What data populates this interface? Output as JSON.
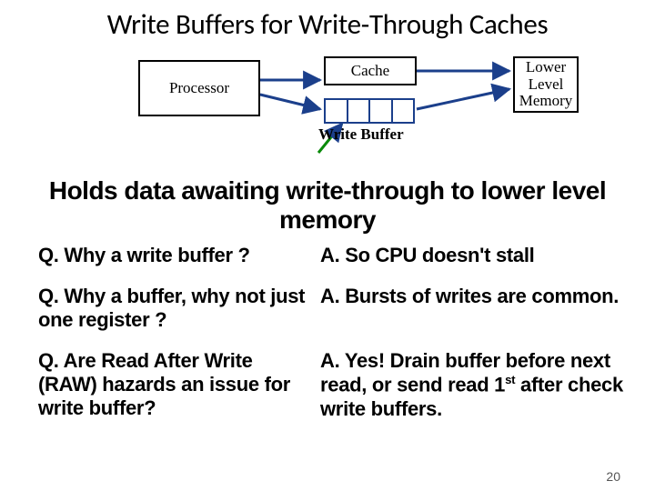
{
  "title": "Write Buffers for Write-Through Caches",
  "diagram": {
    "processor": "Processor",
    "cache": "Cache",
    "memory": "Lower Level Memory",
    "write_buffer_label": "Write Buffer",
    "buffer_slots": 4
  },
  "subtitle": "Holds data awaiting write-through to lower level memory",
  "qa": [
    {
      "q": "Q. Why a write buffer ?",
      "a": "A. So CPU doesn't stall"
    },
    {
      "q": "Q. Why a buffer, why not just one register ?",
      "a": "A. Bursts of writes are common."
    },
    {
      "q": "Q. Are Read After Write (RAW) hazards an issue for write buffer?",
      "a": "A. Yes!  Drain buffer before next read, or send read 1<sup>st</sup> after check write buffers."
    }
  ],
  "page_number": "20"
}
